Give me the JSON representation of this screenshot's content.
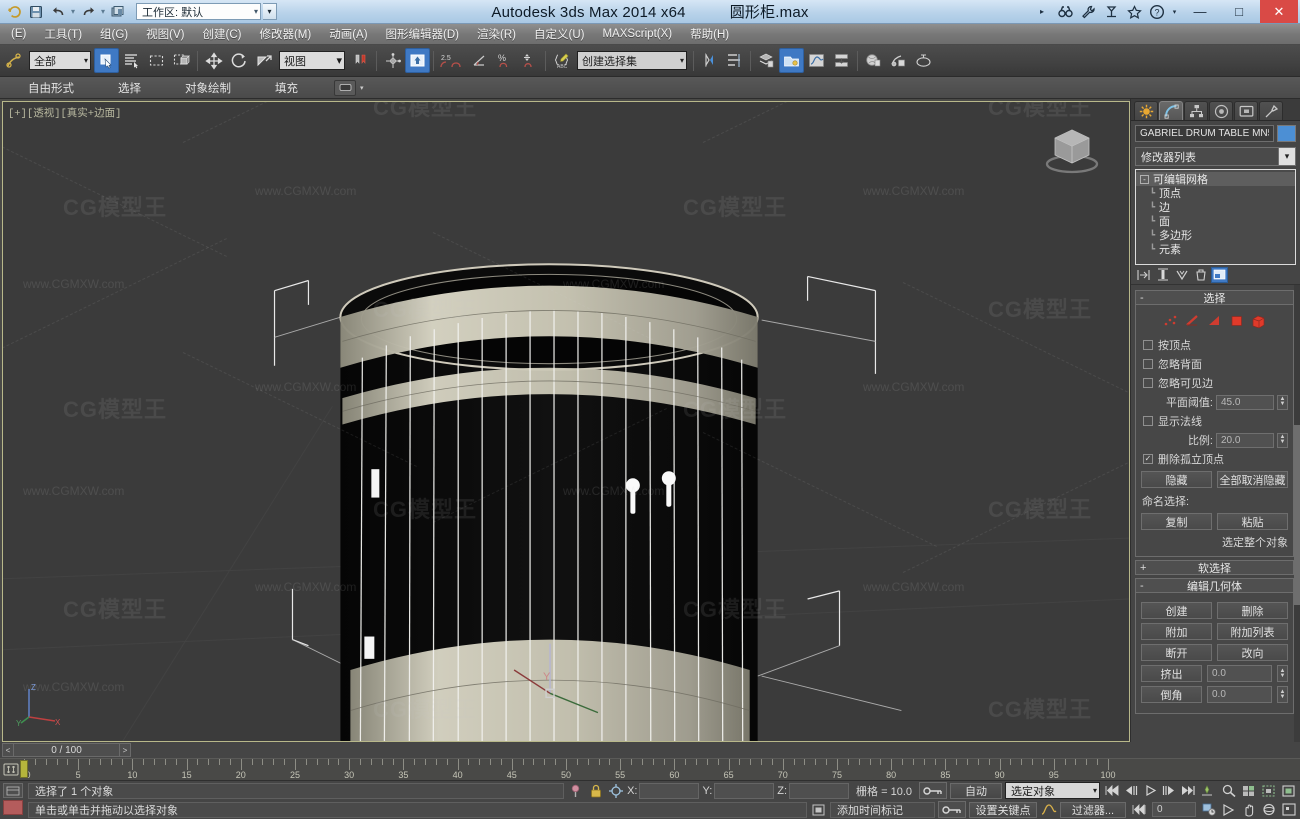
{
  "window": {
    "app_title": "Autodesk 3ds Max  2014 x64",
    "file_name": "圆形柜.max",
    "workspace_label": "工作区: 默认",
    "minimize": "—",
    "maximize": "□",
    "close": "✕"
  },
  "quick_access": [
    {
      "name": "app-menu-icon",
      "glyph": "↻"
    },
    {
      "name": "save-icon",
      "glyph": "💾"
    },
    {
      "name": "undo-icon",
      "glyph": "↩"
    },
    {
      "name": "redo-icon",
      "glyph": "↪"
    },
    {
      "name": "project-folder-icon",
      "glyph": "🗂"
    }
  ],
  "title_icons": [
    {
      "name": "search-box-icon",
      "glyph": "▸"
    },
    {
      "name": "binoculars-icon",
      "glyph": "🕶"
    },
    {
      "name": "wrench-icon",
      "glyph": "🔧"
    },
    {
      "name": "autodesk-360-icon",
      "glyph": "🔭"
    },
    {
      "name": "favorites-star-icon",
      "glyph": "☆"
    },
    {
      "name": "help-icon",
      "glyph": "?"
    },
    {
      "name": "help-dropdown-icon",
      "glyph": "▾"
    }
  ],
  "menus": [
    "(E)",
    "工具(T)",
    "组(G)",
    "视图(V)",
    "创建(C)",
    "修改器(M)",
    "动画(A)",
    "图形编辑器(D)",
    "渲染(R)",
    "自定义(U)",
    "MAXScript(X)",
    "帮助(H)"
  ],
  "toolbar": {
    "selection_filter": "全部",
    "reference_coord": "视图",
    "named_selection_set": "创建选择集",
    "angle_snap_value": "2.5"
  },
  "ribbon": {
    "tabs": [
      "自由形式",
      "选择",
      "对象绘制",
      "填充"
    ],
    "caret": "▾"
  },
  "viewport": {
    "label": "[+][透视][真实+边面]",
    "watermark_logo": "CG模型王",
    "watermark_url": "www.CGMXW.com",
    "axis_x": "X",
    "axis_y": "Y",
    "axis_z": "Z"
  },
  "command_panel": {
    "tabs": [
      {
        "name": "tab-create",
        "glyph": "✷"
      },
      {
        "name": "tab-modify",
        "glyph": "◞"
      },
      {
        "name": "tab-hierarchy",
        "glyph": "⛬"
      },
      {
        "name": "tab-motion",
        "glyph": "◎"
      },
      {
        "name": "tab-display",
        "glyph": "◻"
      },
      {
        "name": "tab-utilities",
        "glyph": "⚒"
      }
    ],
    "object_name": "GABRIEL DRUM TABLE MN5536",
    "object_color": "#4c8fd4",
    "modifier_list_label": "修改器列表",
    "modifier_stack": [
      {
        "label": "可编辑网格",
        "level": 0,
        "selected": true
      },
      {
        "label": "顶点",
        "level": 1,
        "selected": false
      },
      {
        "label": "边",
        "level": 1,
        "selected": false
      },
      {
        "label": "面",
        "level": 1,
        "selected": false
      },
      {
        "label": "多边形",
        "level": 1,
        "selected": false
      },
      {
        "label": "元素",
        "level": 1,
        "selected": false
      }
    ],
    "stack_tools": [
      {
        "name": "pin-stack-icon",
        "glyph": "⇥|"
      },
      {
        "name": "show-end-result-icon",
        "glyph": "⌶"
      },
      {
        "name": "make-unique-icon",
        "glyph": "⩔"
      },
      {
        "name": "remove-modifier-icon",
        "glyph": "♆"
      },
      {
        "name": "configure-modifier-sets-icon",
        "glyph": "▣"
      }
    ],
    "selection_rollout": {
      "title": "选择",
      "collapse": "-",
      "sub_object_icons": [
        {
          "name": "vertex-subobject-icon",
          "glyph": "⋰"
        },
        {
          "name": "edge-subobject-icon",
          "glyph": "◣"
        },
        {
          "name": "face-subobject-icon",
          "glyph": "◤"
        },
        {
          "name": "polygon-subobject-icon",
          "glyph": "■"
        },
        {
          "name": "element-subobject-icon",
          "glyph": "▧"
        }
      ],
      "by_vertex": "按顶点",
      "ignore_backfacing": "忽略背面",
      "ignore_visible_edges": "忽略可见边",
      "planar_threshold_label": "平面阈值:",
      "planar_threshold_value": "45.0",
      "show_normals": "显示法线",
      "scale_label": "比例:",
      "scale_value": "20.0",
      "delete_isolated_vertices": "删除孤立顶点",
      "hide_button": "隐藏",
      "unhide_all_button": "全部取消隐藏",
      "named_selection_label": "命名选择:",
      "copy_button": "复制",
      "paste_button": "粘贴",
      "status_text": "选定整个对象"
    },
    "soft_selection_rollout": {
      "title": "软选择",
      "expand": "+"
    },
    "edit_geometry_rollout": {
      "title": "编辑几何体",
      "collapse": "-",
      "create_button": "创建",
      "delete_button": "删除",
      "attach_button": "附加",
      "attach_list_button": "附加列表",
      "break_button": "断开",
      "turn_button": "改向",
      "extrude_label": "挤出",
      "extrude_value": "0.0",
      "bevel_label": "倒角",
      "bevel_value": "0.0"
    }
  },
  "timeline": {
    "current_frame": "0 / 100",
    "prev_arrow": "<",
    "next_arrow": ">",
    "ticks": [
      0,
      5,
      10,
      15,
      20,
      25,
      30,
      35,
      40,
      45,
      50,
      55,
      60,
      65,
      70,
      75,
      80,
      85,
      90,
      95,
      100
    ],
    "slider_frame": 0
  },
  "status_bar": {
    "selection_status": "选择了 1 个对象",
    "prompt": "单击或单击并拖动以选择对象",
    "icons": [
      {
        "name": "isolate-selection-icon",
        "glyph": "⚲"
      },
      {
        "name": "selection-lock-icon",
        "glyph": "🔒"
      },
      {
        "name": "absolute-relative-mode-icon",
        "glyph": "✥"
      }
    ],
    "coord_x_label": "X:",
    "coord_y_label": "Y:",
    "coord_z_label": "Z:",
    "coord_x_value": "",
    "coord_y_value": "",
    "coord_z_value": "",
    "grid_info": "栅格 = 10.0",
    "add_time_tag": "添加时间标记",
    "key_mode_icon": "⚿",
    "auto_key_button": "自动",
    "set_key_button": "设置关键点",
    "key_filter_select": "选定对象",
    "curve_icon": "∿",
    "filters_button": "过滤器...",
    "playback": [
      {
        "name": "goto-start-icon",
        "glyph": "|◀◀"
      },
      {
        "name": "prev-frame-icon",
        "glyph": "◀||"
      },
      {
        "name": "play-icon",
        "glyph": "▷"
      },
      {
        "name": "next-frame-icon",
        "glyph": "||▶"
      },
      {
        "name": "goto-end-icon",
        "glyph": "▶▶|"
      },
      {
        "name": "key-mode-toggle-icon",
        "glyph": "⊹"
      }
    ],
    "current_frame_field": "0",
    "time-config": [
      {
        "name": "time-configuration-icon",
        "glyph": "▦"
      }
    ],
    "nav_row1": [
      {
        "name": "zoom-icon",
        "glyph": "🔍"
      },
      {
        "name": "zoom-all-icon",
        "glyph": "⊞"
      },
      {
        "name": "zoom-extents-icon",
        "glyph": "⬚"
      },
      {
        "name": "zoom-region-icon",
        "glyph": "▣"
      }
    ],
    "nav_row2": [
      {
        "name": "field-of-view-icon",
        "glyph": "⊡"
      },
      {
        "name": "walk-through-icon",
        "glyph": "▷"
      },
      {
        "name": "pan-icon",
        "glyph": "✋"
      },
      {
        "name": "orbit-icon",
        "glyph": "◐"
      },
      {
        "name": "maximize-viewport-icon",
        "glyph": "⛶"
      }
    ]
  }
}
